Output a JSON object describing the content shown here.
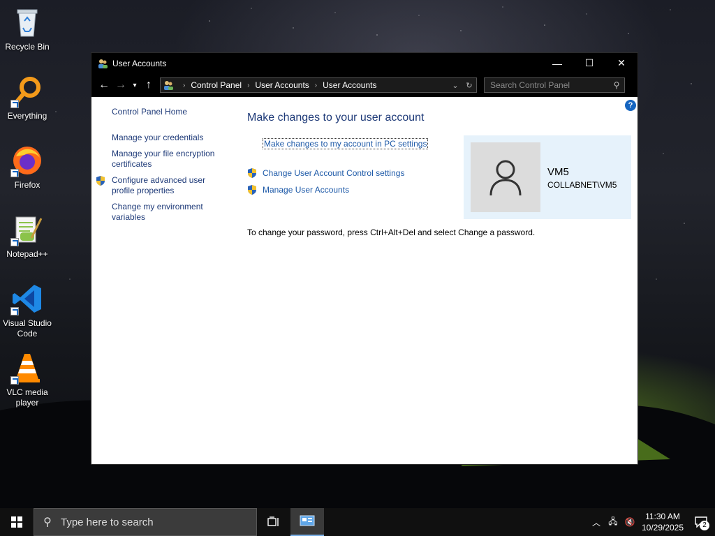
{
  "desktop": {
    "icons": [
      {
        "label": "Recycle Bin",
        "icon": "recycle-bin-icon"
      },
      {
        "label": "Everything",
        "icon": "everything-search-icon"
      },
      {
        "label": "Firefox",
        "icon": "firefox-icon"
      },
      {
        "label": "Notepad++",
        "icon": "notepad-plus-plus-icon"
      },
      {
        "label": "Visual Studio Code",
        "icon": "vscode-icon"
      },
      {
        "label": "VLC media player",
        "icon": "vlc-icon"
      }
    ]
  },
  "window": {
    "title": "User Accounts",
    "controls": {
      "minimize": "—",
      "maximize": "☐",
      "close": "✕"
    },
    "breadcrumb": [
      "Control Panel",
      "User Accounts",
      "User Accounts"
    ],
    "search_placeholder": "Search Control Panel",
    "help": "?",
    "left_nav": {
      "home": "Control Panel Home",
      "items": [
        {
          "label": "Manage your credentials",
          "shield": false
        },
        {
          "label": "Manage your file encryption certificates",
          "shield": false
        },
        {
          "label": "Configure advanced user profile properties",
          "shield": true
        },
        {
          "label": "Change my environment variables",
          "shield": false
        }
      ]
    },
    "main": {
      "heading": "Make changes to your user account",
      "settings_link": "Make changes to my account in PC settings",
      "uac_links": [
        "Change User Account Control settings",
        "Manage User Accounts"
      ],
      "password_note": "To change your password, press Ctrl+Alt+Del and select Change a password."
    },
    "user": {
      "name": "VM5",
      "domain": "COLLABNET\\VM5"
    }
  },
  "taskbar": {
    "search_placeholder": "Type here to search",
    "time": "11:30 AM",
    "date": "10/29/2025",
    "notification_count": "2"
  }
}
